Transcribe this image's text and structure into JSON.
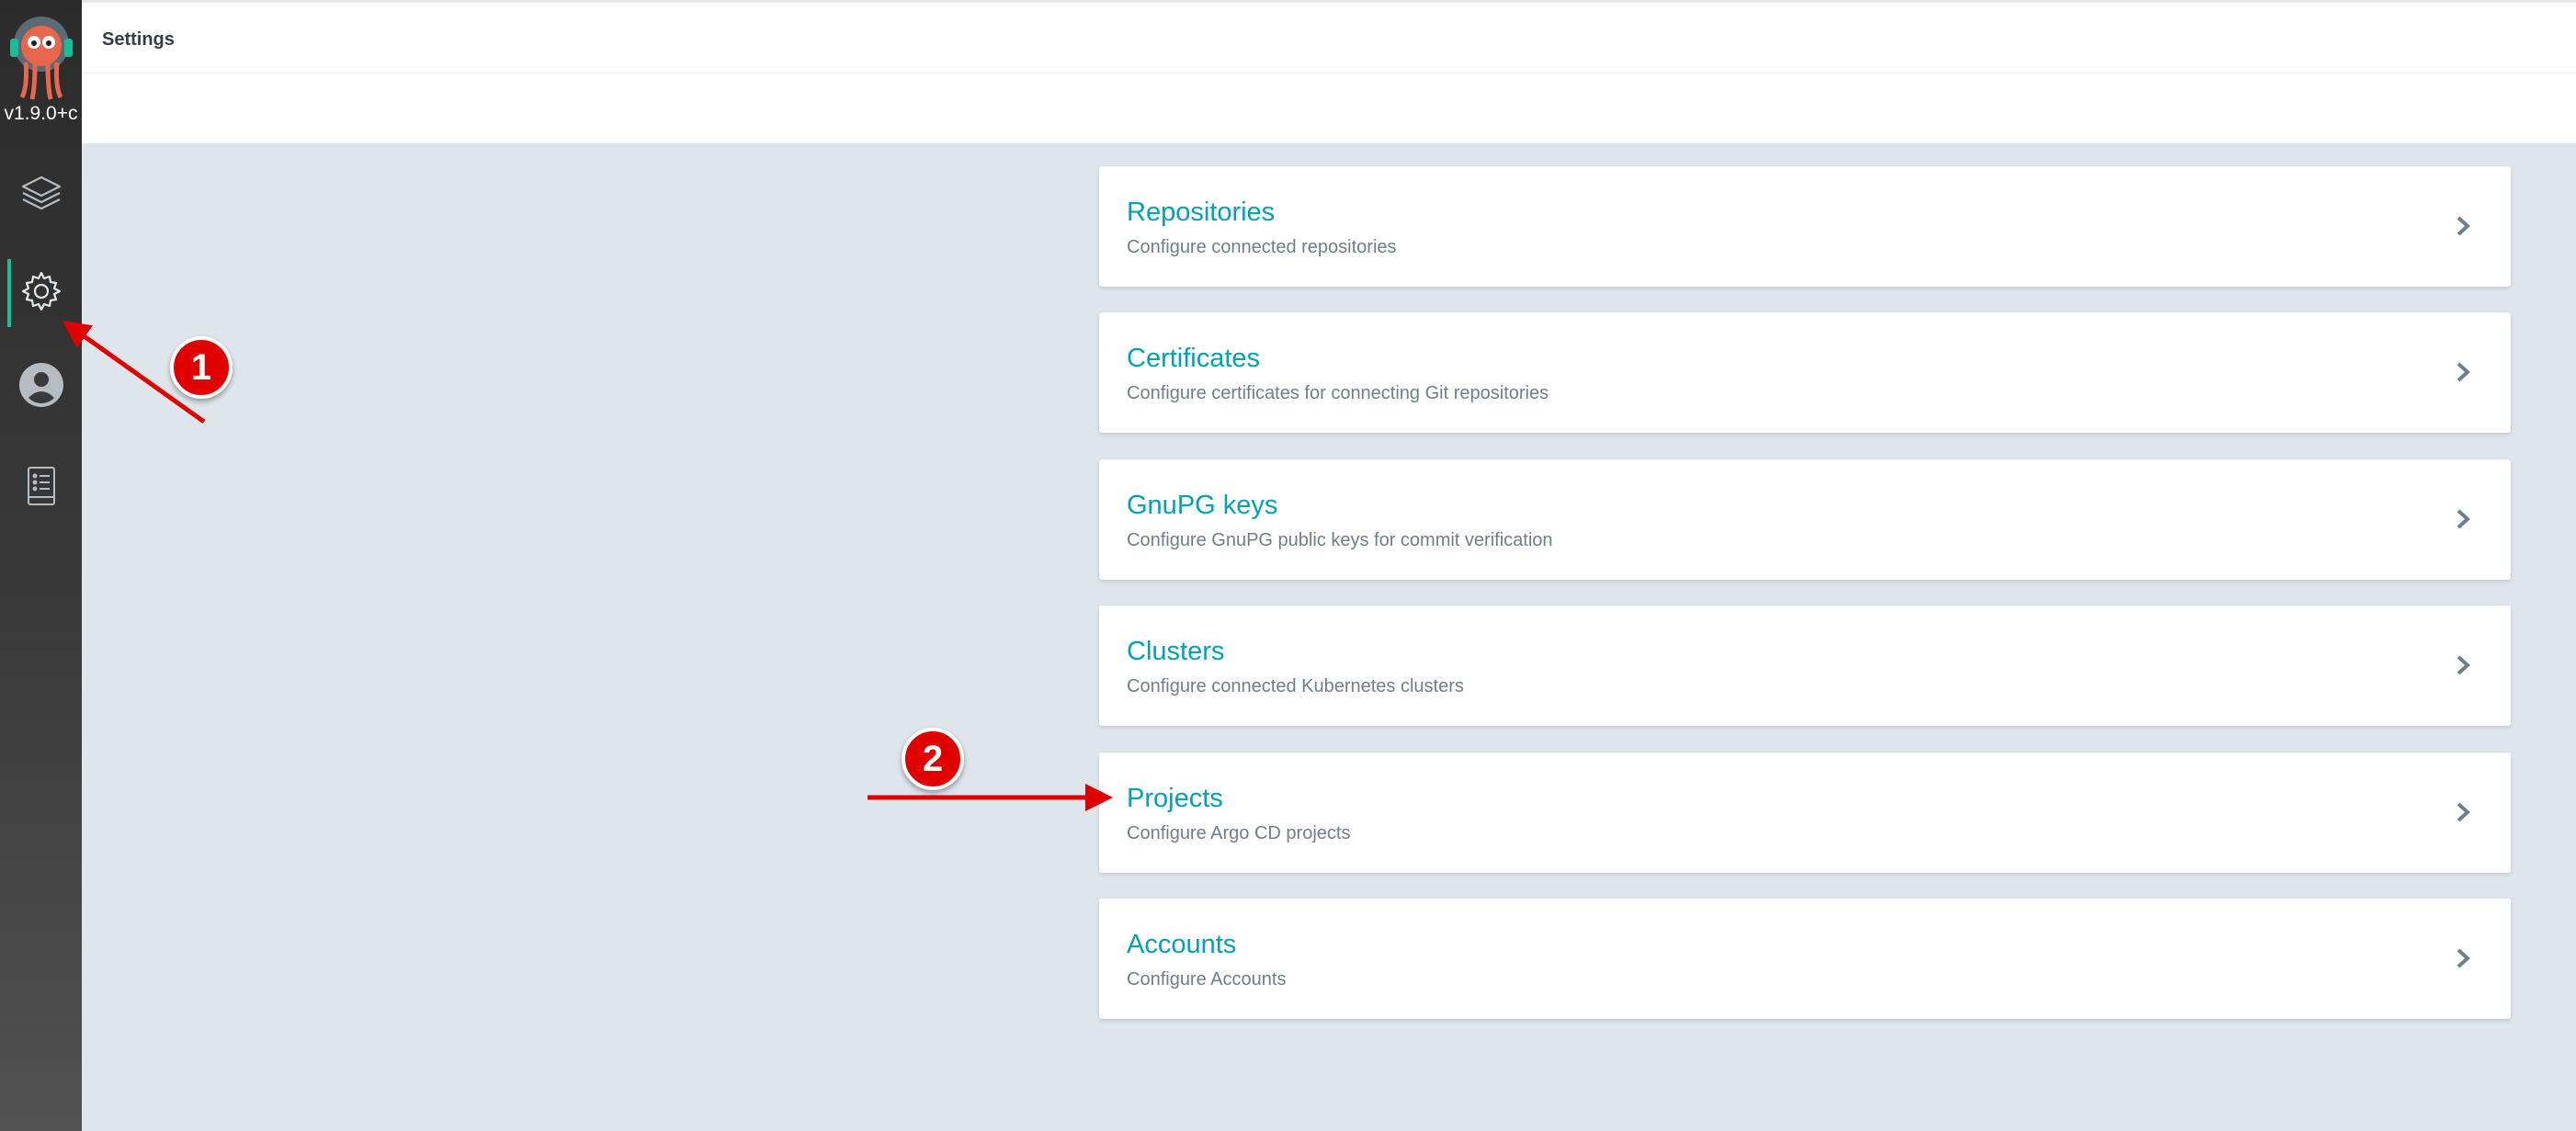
{
  "app": {
    "version": "v1.9.0+c"
  },
  "sidebar": {
    "items": [
      {
        "icon": "layers-icon",
        "active": false
      },
      {
        "icon": "gear-icon",
        "active": true
      },
      {
        "icon": "user-icon",
        "active": false
      },
      {
        "icon": "docs-icon",
        "active": false
      }
    ]
  },
  "header": {
    "title": "Settings"
  },
  "settings": {
    "cards": [
      {
        "title": "Repositories",
        "description": "Configure connected repositories"
      },
      {
        "title": "Certificates",
        "description": "Configure certificates for connecting Git repositories"
      },
      {
        "title": "GnuPG keys",
        "description": "Configure GnuPG public keys for commit verification"
      },
      {
        "title": "Clusters",
        "description": "Configure connected Kubernetes clusters"
      },
      {
        "title": "Projects",
        "description": "Configure Argo CD projects"
      },
      {
        "title": "Accounts",
        "description": "Configure Accounts"
      }
    ]
  },
  "annotations": {
    "marker_1": "1",
    "marker_2": "2"
  },
  "colors": {
    "accent": "#00a2b3",
    "active_indicator": "#18be94",
    "annotation": "#e10000",
    "background": "#dee6eb"
  }
}
